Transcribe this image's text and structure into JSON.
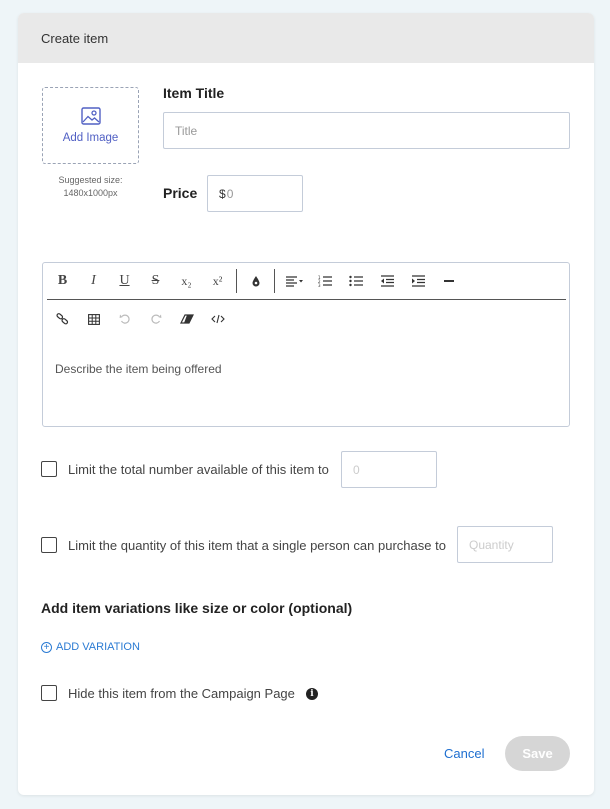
{
  "header": {
    "title": "Create item"
  },
  "image": {
    "add_label": "Add Image",
    "size_hint_line1": "Suggested size:",
    "size_hint_line2": "1480x1000px"
  },
  "title_field": {
    "label": "Item Title",
    "placeholder": "Title"
  },
  "price_field": {
    "label": "Price",
    "currency": "$",
    "placeholder": "0"
  },
  "editor": {
    "toolbar_row1": [
      "B",
      "I",
      "U",
      "S",
      "x₂",
      "x²"
    ],
    "placeholder": "Describe the item being offered"
  },
  "limit_total": {
    "label": "Limit the total number available of this item to",
    "placeholder": "0"
  },
  "limit_per_person": {
    "label": "Limit the quantity of this item that a single person can purchase to",
    "placeholder": "Quantity"
  },
  "variations": {
    "heading": "Add item variations like size or color (optional)",
    "add_label": "ADD VARIATION"
  },
  "hide_item": {
    "label": "Hide this item from the Campaign Page",
    "info_glyph": "i"
  },
  "footer": {
    "cancel_label": "Cancel",
    "save_label": "Save"
  },
  "colors": {
    "accent": "#2b7bd3",
    "image_label": "#5160c4",
    "save_disabled": "#d6d6d6",
    "header_bg": "#e9e9e9"
  }
}
